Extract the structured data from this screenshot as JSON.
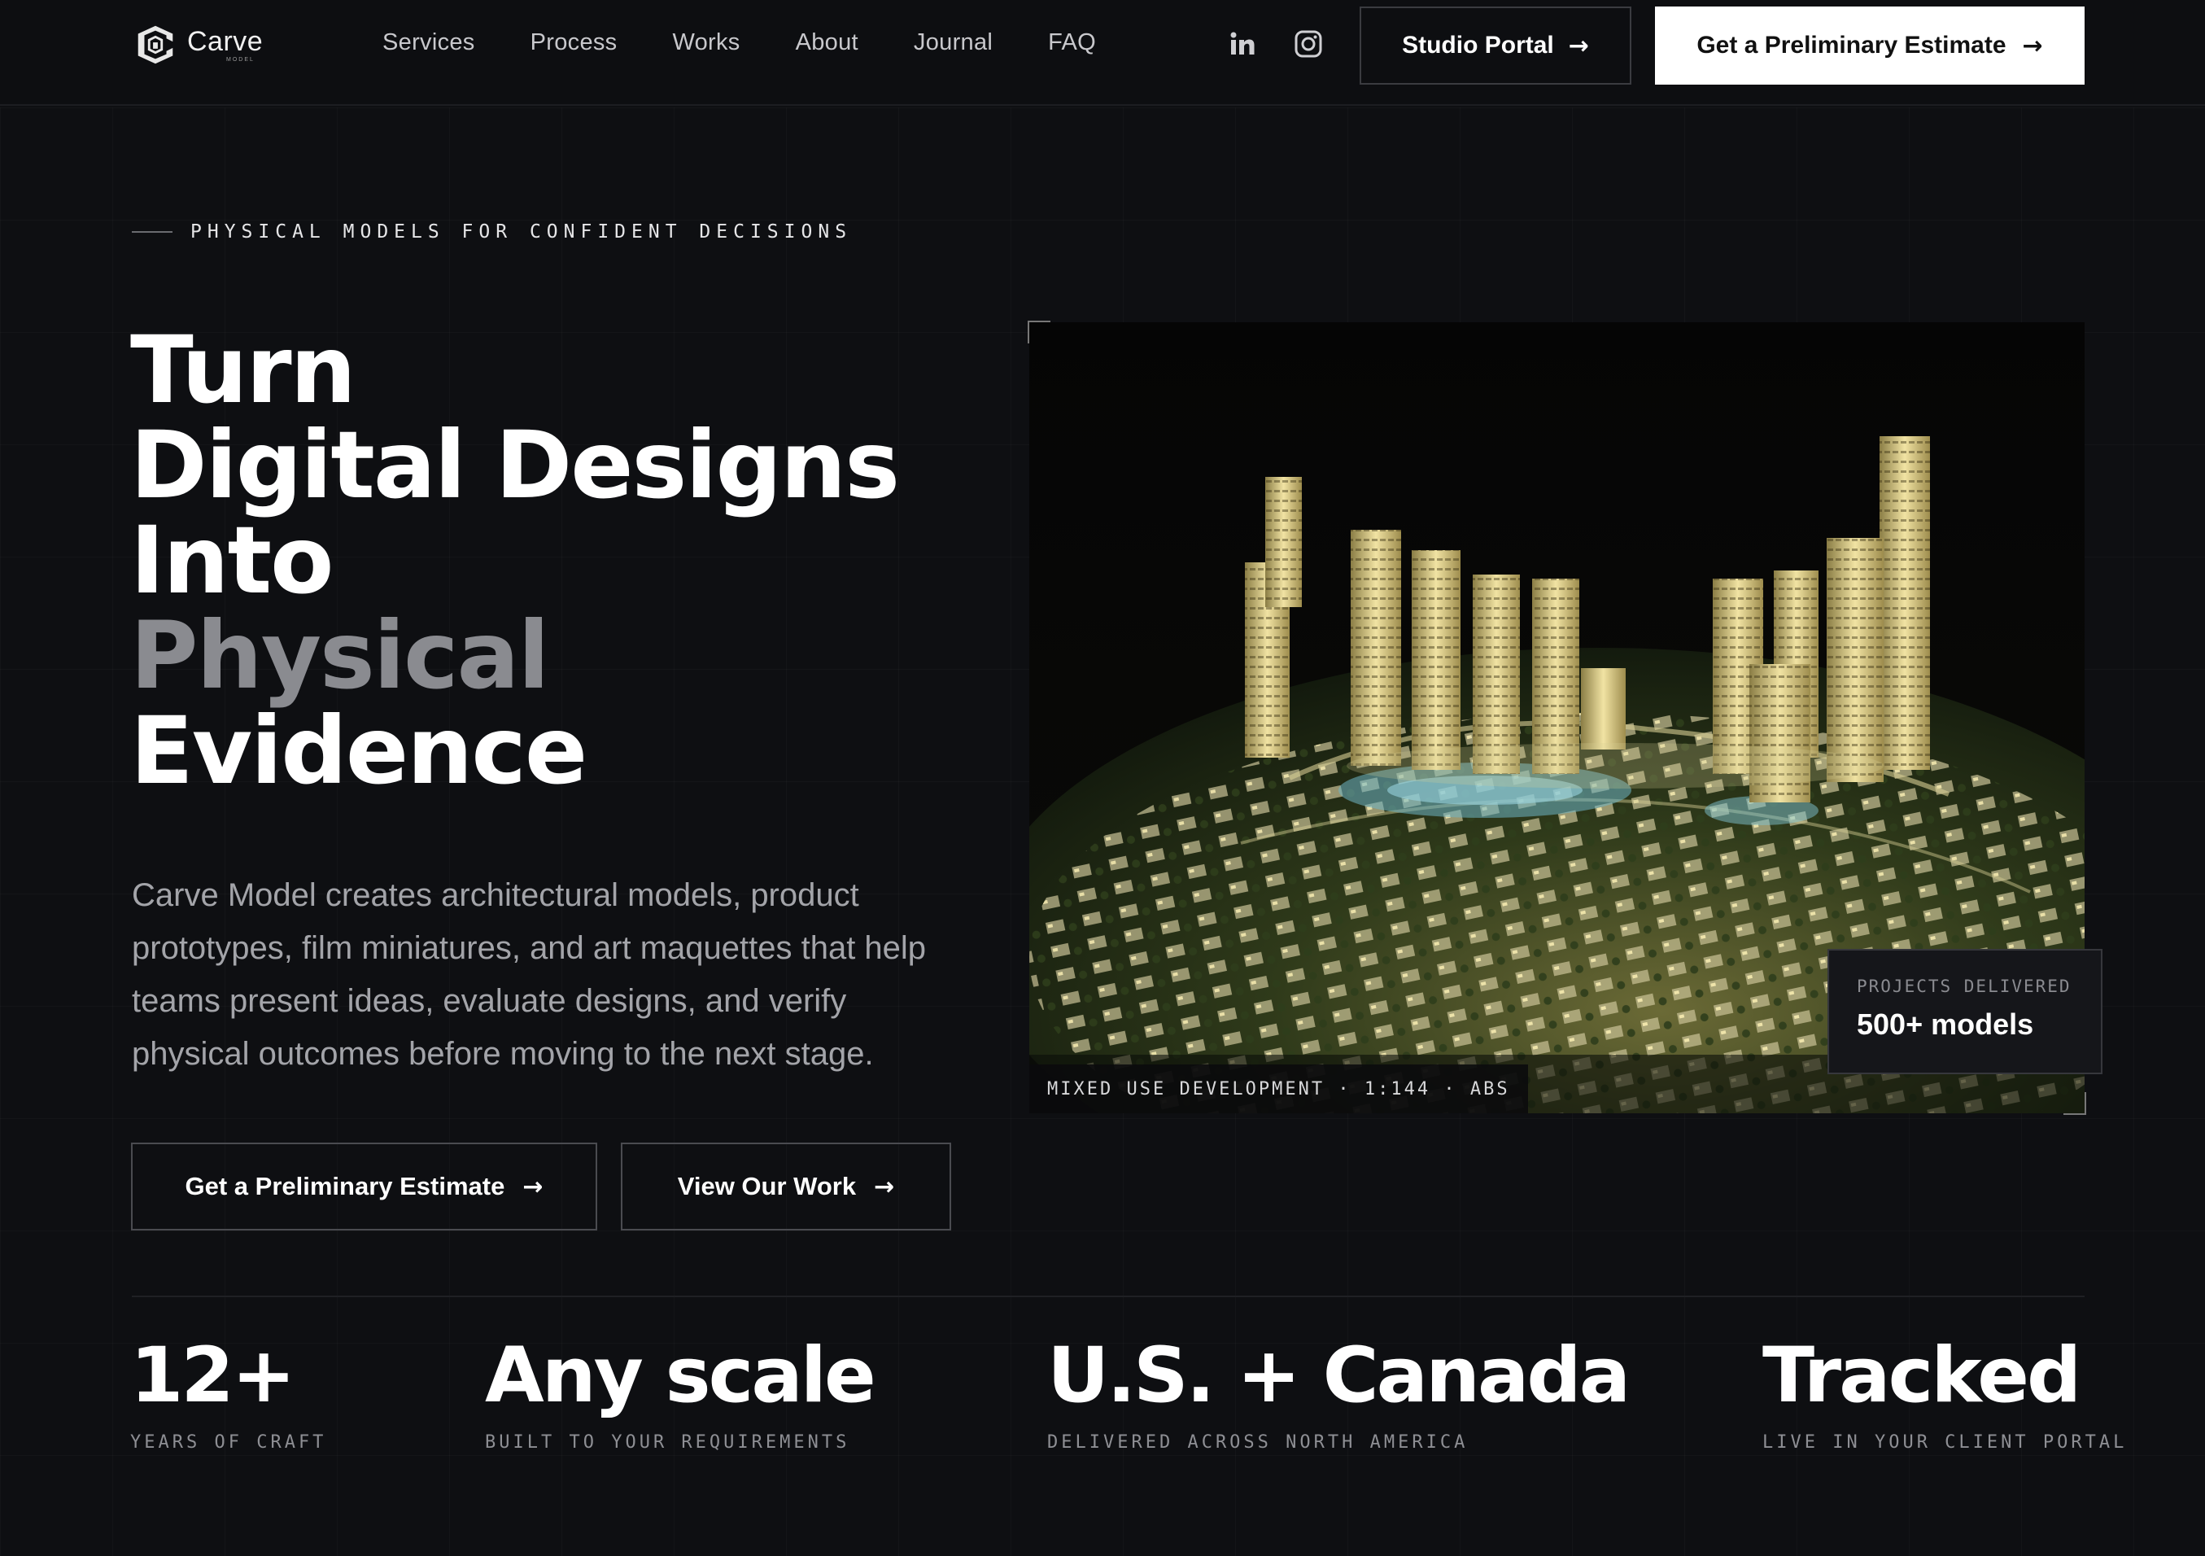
{
  "brand": {
    "name": "Carve",
    "sub": "MODEL"
  },
  "nav": {
    "links": [
      "Services",
      "Process",
      "Works",
      "About",
      "Journal",
      "FAQ"
    ],
    "social": [
      "linkedin-icon",
      "instagram-icon"
    ],
    "portal_label": "Studio Portal",
    "estimate_label": "Get a Preliminary Estimate"
  },
  "hero": {
    "eyebrow": "PHYSICAL MODELS FOR CONFIDENT DECISIONS",
    "headline": [
      "Turn",
      "Digital Designs",
      "Into",
      "Physical",
      "Evidence"
    ],
    "lede": "Carve Model creates architectural models, product prototypes, film miniatures, and art maquettes that help teams present ideas, evaluate designs, and verify physical outcomes before moving to the next stage.",
    "primary_cta": "Get a Preliminary Estimate",
    "secondary_cta": "View Our Work",
    "image_caption": "MIXED USE DEVELOPMENT · 1:144 · ABS",
    "card_label": "PROJECTS DELIVERED",
    "card_value": "500+ models"
  },
  "stats": [
    {
      "value": "12+",
      "label": "YEARS OF CRAFT"
    },
    {
      "value": "Any scale",
      "label": "BUILT TO YOUR REQUIREMENTS"
    },
    {
      "value": "U.S. + Canada",
      "label": "DELIVERED ACROSS NORTH AMERICA"
    },
    {
      "value": "Tracked",
      "label": "LIVE IN YOUR CLIENT PORTAL"
    }
  ],
  "colors": {
    "background": "#0e0f12",
    "muted_text": "#8a8b90",
    "accent_button": "#ffffff"
  }
}
